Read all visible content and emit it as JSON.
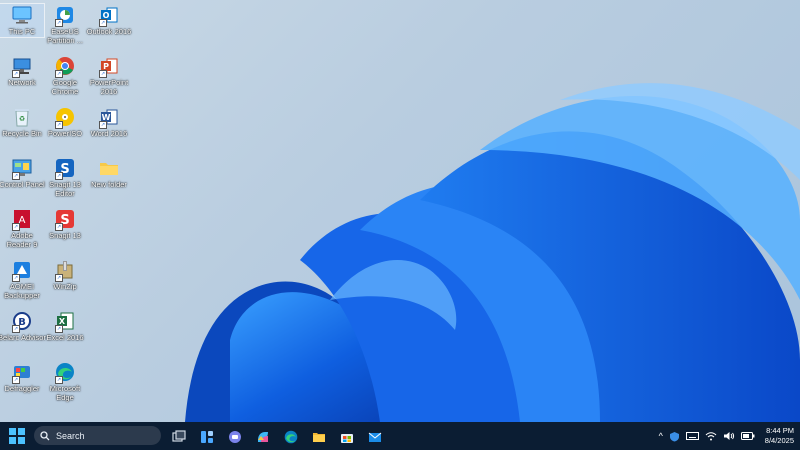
{
  "desktop_icons": [
    {
      "label": "This PC",
      "icon": "this-pc-icon",
      "selected": true
    },
    {
      "label": "EaseUS Partition ...",
      "icon": "easeus-partition-icon"
    },
    {
      "label": "Outlook 2016",
      "icon": "outlook-icon"
    },
    {
      "label": "Network",
      "icon": "network-icon"
    },
    {
      "label": "Google Chrome",
      "icon": "chrome-icon"
    },
    {
      "label": "PowerPoint 2016",
      "icon": "powerpoint-icon"
    },
    {
      "label": "Recycle Bin",
      "icon": "recycle-bin-icon"
    },
    {
      "label": "PowerISO",
      "icon": "poweriso-icon"
    },
    {
      "label": "Word 2016",
      "icon": "word-icon"
    },
    {
      "label": "Control Panel",
      "icon": "control-panel-icon"
    },
    {
      "label": "Snagit 13 Editor",
      "icon": "snagit-editor-icon"
    },
    {
      "label": "New folder",
      "icon": "folder-icon"
    },
    {
      "label": "Adobe Reader 9",
      "icon": "adobe-reader-icon"
    },
    {
      "label": "Snagit 13",
      "icon": "snagit-icon"
    },
    {
      "label": "AOMEI Backupper",
      "icon": "aomei-icon"
    },
    {
      "label": "WinZip",
      "icon": "winzip-icon"
    },
    {
      "label": "Belarc Advisor",
      "icon": "belarc-icon"
    },
    {
      "label": "Excel 2016",
      "icon": "excel-icon"
    },
    {
      "label": "Defraggler",
      "icon": "defraggler-icon"
    },
    {
      "label": "Microsoft Edge",
      "icon": "edge-icon"
    }
  ],
  "taskbar": {
    "search_label": "Search",
    "apps": [
      "task-view-icon",
      "widgets-icon",
      "teams-chat-icon",
      "copilot-icon",
      "edge-icon",
      "file-explorer-icon",
      "microsoft-store-icon",
      "mail-icon"
    ],
    "tray_icons": [
      "show-hidden-icons-chevron-icon",
      "security-icon",
      "keyboard-icon",
      "wifi-icon",
      "volume-icon",
      "battery-icon"
    ],
    "time": "8:44 PM",
    "date": "8/4/2025"
  },
  "colors": {
    "accent": "#1e6fe0",
    "taskbar": "#0b1d33",
    "start": "#4cc2ff"
  }
}
